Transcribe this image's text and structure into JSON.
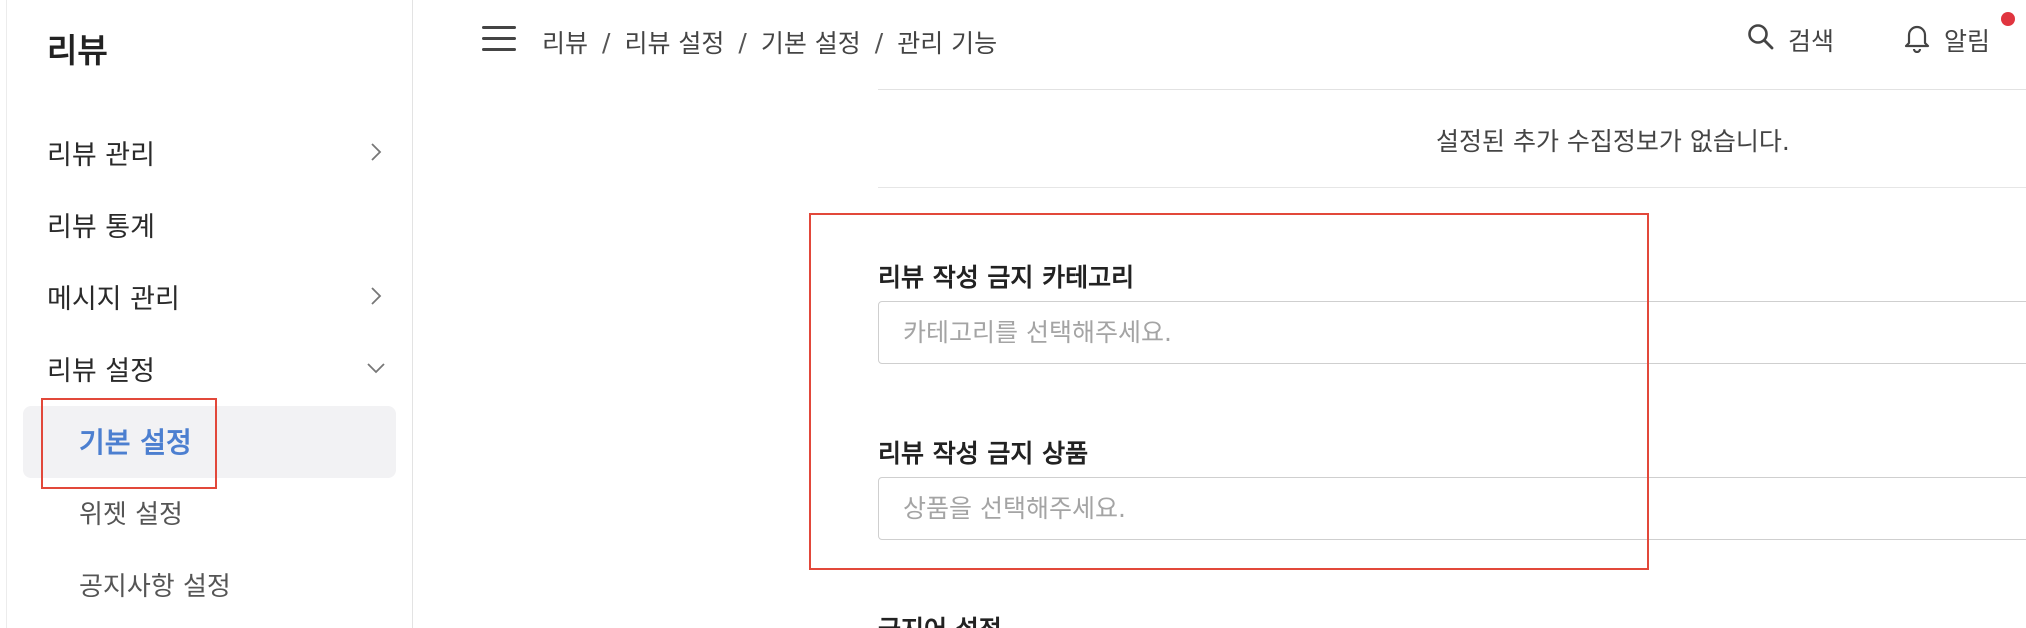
{
  "sidebar": {
    "title": "리뷰",
    "menu": [
      {
        "label": "리뷰 관리",
        "chevron": "chevron-right-icon"
      },
      {
        "label": "리뷰 통계"
      },
      {
        "label": "메시지 관리",
        "chevron": "chevron-right-icon"
      },
      {
        "label": "리뷰 설정",
        "chevron": "chevron-down-icon",
        "expanded": true
      }
    ],
    "submenu": [
      {
        "label": "기본 설정",
        "active": true
      },
      {
        "label": "위젯 설정"
      },
      {
        "label": "공지사항 설정"
      }
    ]
  },
  "header": {
    "breadcrumb": [
      "리뷰",
      "리뷰 설정",
      "기본 설정",
      "관리 기능"
    ],
    "separator": "/",
    "search_label": "검색",
    "alarm_label": "알림",
    "notification_dot_color": "#e0353f"
  },
  "main": {
    "empty_notice": "설정된 추가 수집정보가 없습니다.",
    "category_field": {
      "label": "리뷰 작성 금지 카테고리",
      "placeholder": "카테고리를 선택해주세요."
    },
    "product_field": {
      "label": "리뷰 작성 금지 상품",
      "placeholder": "상품을 선택해주세요."
    },
    "next_section_label": "금지어 설정"
  },
  "colors": {
    "active_submenu": "#4c7fd0",
    "highlight_box": "#e2483a"
  }
}
